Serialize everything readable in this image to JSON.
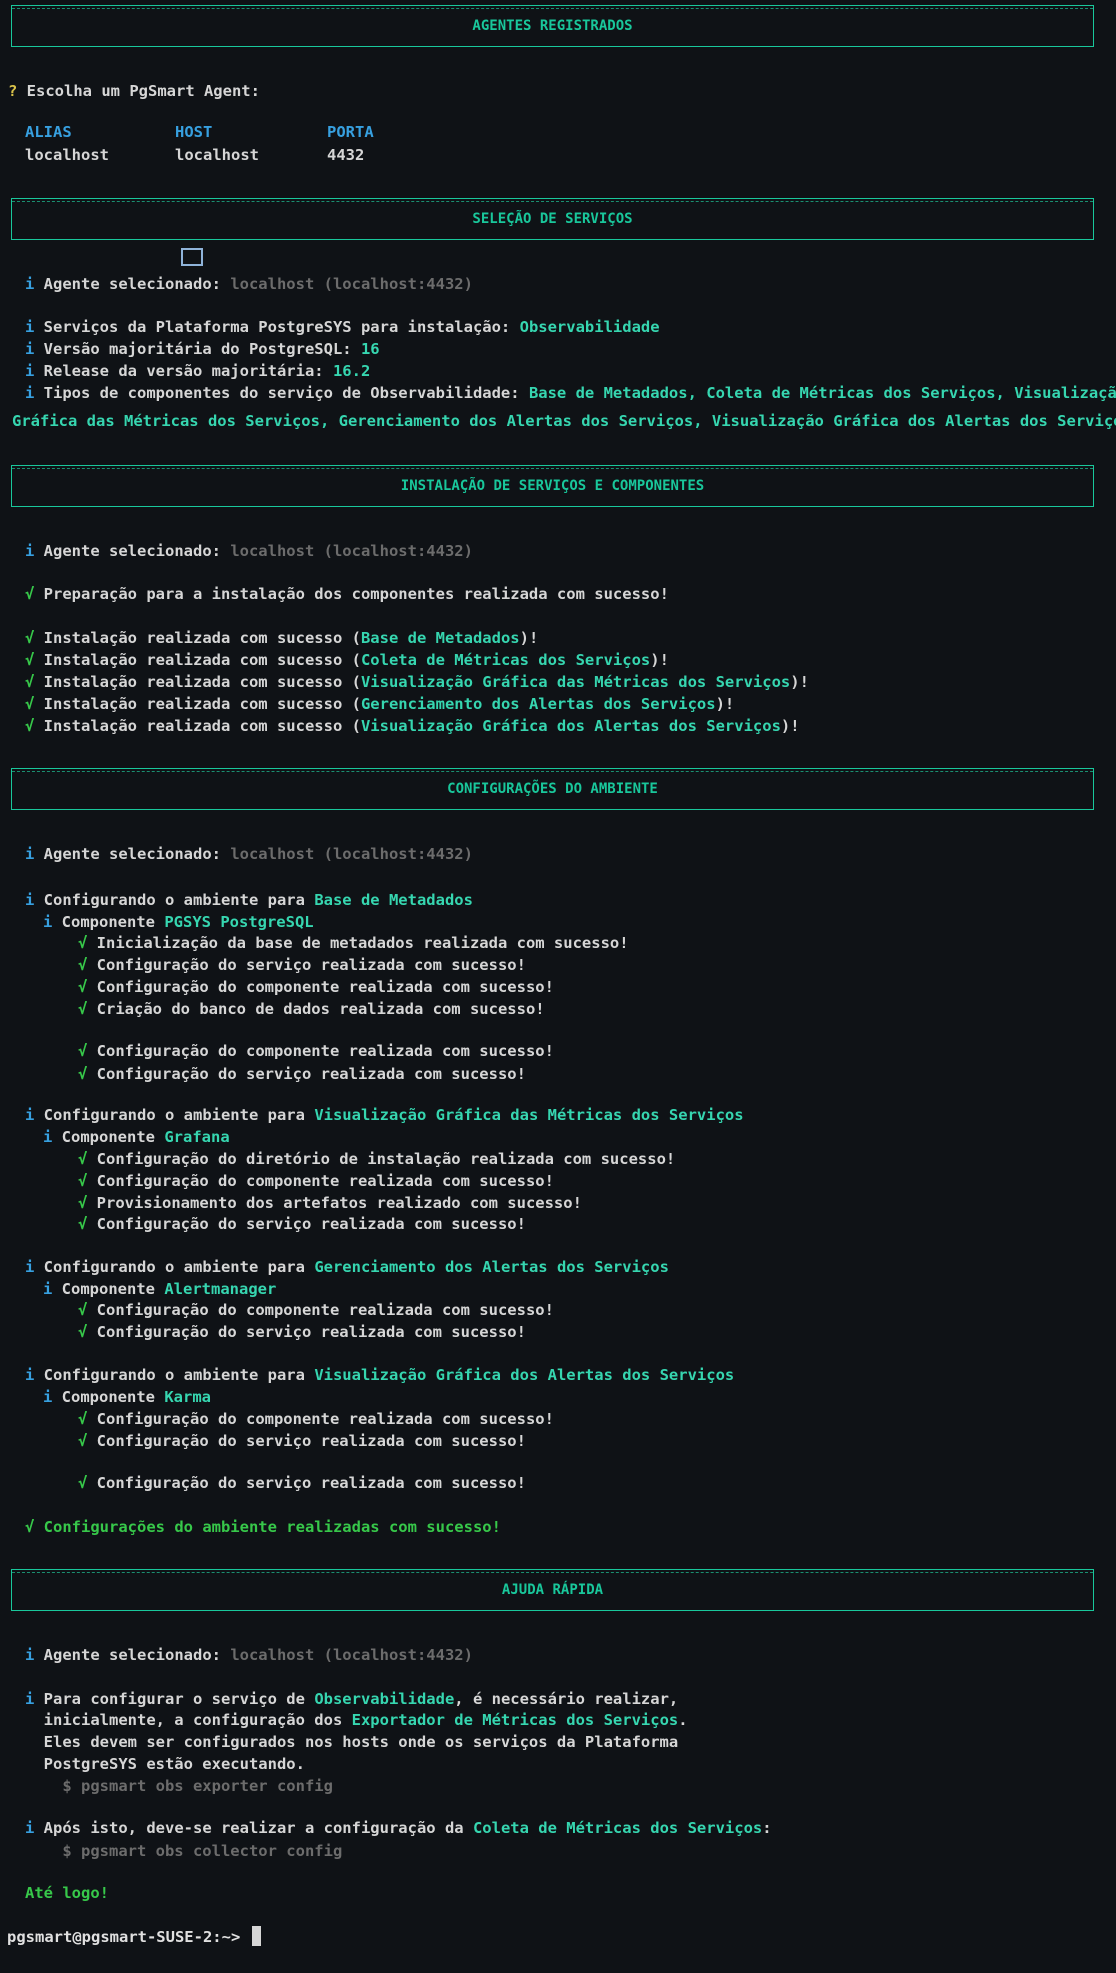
{
  "sections": {
    "registered": "AGENTES REGISTRADOS",
    "services": "SELEÇÃO DE SERVIÇOS",
    "install": "INSTALAÇÃO DE SERVIÇOS E COMPONENTES",
    "config": "CONFIGURAÇÕES DO AMBIENTE",
    "help": "AJUDA RÁPIDA"
  },
  "agents": {
    "q_mark": "?",
    "prompt": " Escolha um PgSmart Agent:",
    "headers": [
      "ALIAS",
      "HOST",
      "PORTA"
    ],
    "row": [
      "localhost",
      "localhost",
      "4432"
    ]
  },
  "common": {
    "i": "i",
    "check": "√",
    "agent_label": " Agente selecionado: ",
    "agent_value": "localhost (localhost:4432)",
    "ok_comp": " Configuração do componente realizada com sucesso!",
    "ok_serv": " Configuração do serviço realizada com sucesso!",
    "env_prefix": " Configurando o ambiente para ",
    "comp_prefix": " Componente ",
    "install_prefix": " Instalação realizada com sucesso (",
    "install_suffix": ")!"
  },
  "services": {
    "l1_label": " Serviços da Plataforma PostgreSYS para instalação: ",
    "l1_value": "Observabilidade",
    "l2_label": " Versão majoritária do PostgreSQL: ",
    "l2_value": "16",
    "l3_label": " Release da versão majoritária: ",
    "l3_value": "16.2",
    "l4_label": " Tipos de componentes do serviço de Observabilidade: ",
    "l4_value_a": "Base de Metadados, Coleta de Métricas dos Serviços, Visualização",
    "l4_value_b": "Gráfica das Métricas dos Serviços, Gerenciamento dos Alertas dos Serviços, Visualização Gráfica dos Alertas dos Serviços"
  },
  "install": {
    "prep": " Preparação para a instalação dos componentes realizada com sucesso!",
    "items": [
      "Base de Metadados",
      "Coleta de Métricas dos Serviços",
      "Visualização Gráfica das Métricas dos Serviços",
      "Gerenciamento dos Alertas dos Serviços",
      "Visualização Gráfica dos Alertas dos Serviços"
    ]
  },
  "config": {
    "env1": "Base de Metadados",
    "comp1": "PGSYS PostgreSQL",
    "c1_init": " Inicialização da base de metadados realizada com sucesso!",
    "c1_db": " Criação do banco de dados realizada com sucesso!",
    "env2": "Visualização Gráfica das Métricas dos Serviços",
    "comp2": "Grafana",
    "c2_dir": " Configuração do diretório de instalação realizada com sucesso!",
    "c2_prov": " Provisionamento dos artefatos realizado com sucesso!",
    "env3": "Gerenciamento dos Alertas dos Serviços",
    "comp3": "Alertmanager",
    "env4": "Visualização Gráfica dos Alertas dos Serviços",
    "comp4": "Karma",
    "final": " Configurações do ambiente realizadas com sucesso!"
  },
  "help": {
    "p1_a": " Para configurar o serviço de ",
    "p1_a_hl": "Observabilidade",
    "p1_a_end": ", é necessário realizar,",
    "p1_b": "  inicialmente, a configuração dos ",
    "p1_b_hl": "Exportador de Métricas dos Serviços",
    "p1_b_end": ".",
    "p1_c": "  Eles devem ser configurados nos hosts onde os serviços da Plataforma",
    "p1_d": "  PostgreSYS estão executando.",
    "cmd1": "    $ pgsmart obs exporter config",
    "p2_a": " Após isto, deve-se realizar a configuração da ",
    "p2_a_hl": "Coleta de Métricas dos Serviços",
    "p2_a_end": ":",
    "cmd2": "    $ pgsmart obs collector config",
    "bye": "Até logo!"
  },
  "prompt": "pgsmart@pgsmart-SUSE-2:~> "
}
